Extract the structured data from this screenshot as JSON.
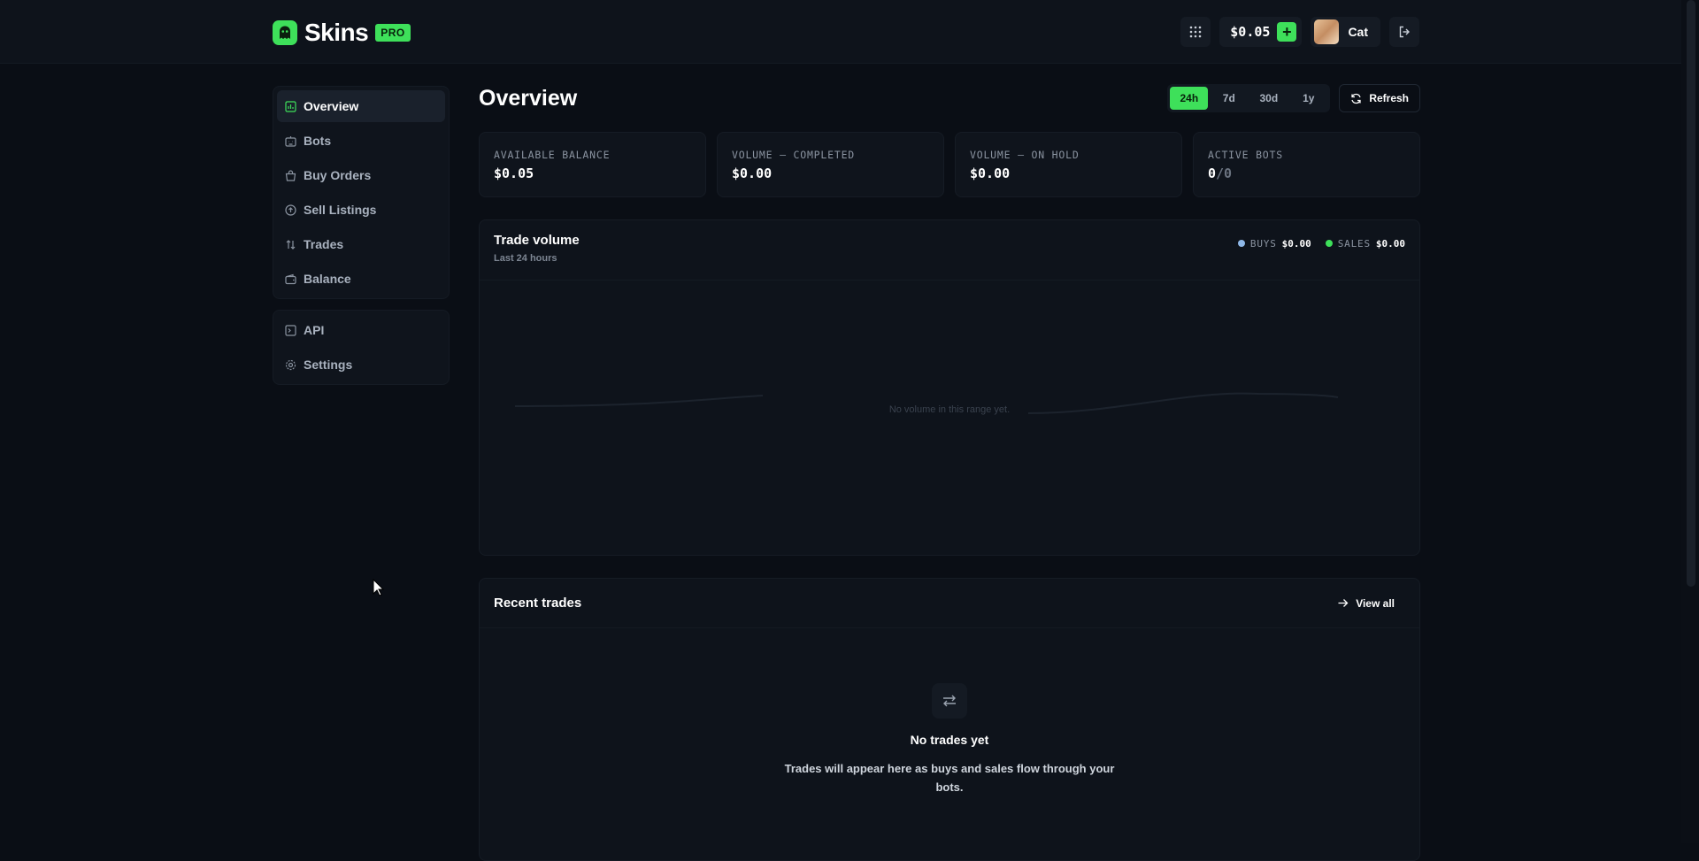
{
  "header": {
    "brand_name": "Skins",
    "brand_badge": "PRO",
    "balance": "$0.05",
    "add_funds": "+",
    "user_name": "Cat"
  },
  "sidebar": {
    "primary": [
      {
        "label": "Overview",
        "icon": "chart-icon",
        "active": true
      },
      {
        "label": "Bots",
        "icon": "bot-icon"
      },
      {
        "label": "Buy Orders",
        "icon": "basket-icon"
      },
      {
        "label": "Sell Listings",
        "icon": "upload-icon"
      },
      {
        "label": "Trades",
        "icon": "swap-icon"
      },
      {
        "label": "Balance",
        "icon": "wallet-icon"
      }
    ],
    "secondary": [
      {
        "label": "API",
        "icon": "terminal-icon"
      },
      {
        "label": "Settings",
        "icon": "gear-icon"
      }
    ]
  },
  "main": {
    "title": "Overview",
    "ranges": [
      "24h",
      "7d",
      "30d",
      "1y"
    ],
    "active_range": "24h",
    "refresh_label": "Refresh",
    "stats": [
      {
        "label": "AVAILABLE BALANCE",
        "value": "$0.05"
      },
      {
        "label": "VOLUME — COMPLETED",
        "value": "$0.00"
      },
      {
        "label": "VOLUME — ON HOLD",
        "value": "$0.00"
      },
      {
        "label": "ACTIVE BOTS",
        "value": "0",
        "value_suffix": "/0"
      }
    ],
    "chart": {
      "title": "Trade volume",
      "subtitle": "Last 24 hours",
      "empty_text": "No volume in this range yet.",
      "legend": [
        {
          "name": "BUYS",
          "value": "$0.00",
          "color": "#8fb8e8"
        },
        {
          "name": "SALES",
          "value": "$0.00",
          "color": "#3ee05a"
        }
      ]
    },
    "recent_trades": {
      "title": "Recent trades",
      "view_all": "View all",
      "empty_title": "No trades yet",
      "empty_desc": "Trades will appear here as buys and sales flow through your bots."
    }
  },
  "colors": {
    "accent": "#3ee05a",
    "background": "#0a0e15",
    "card": "#0f141c"
  }
}
